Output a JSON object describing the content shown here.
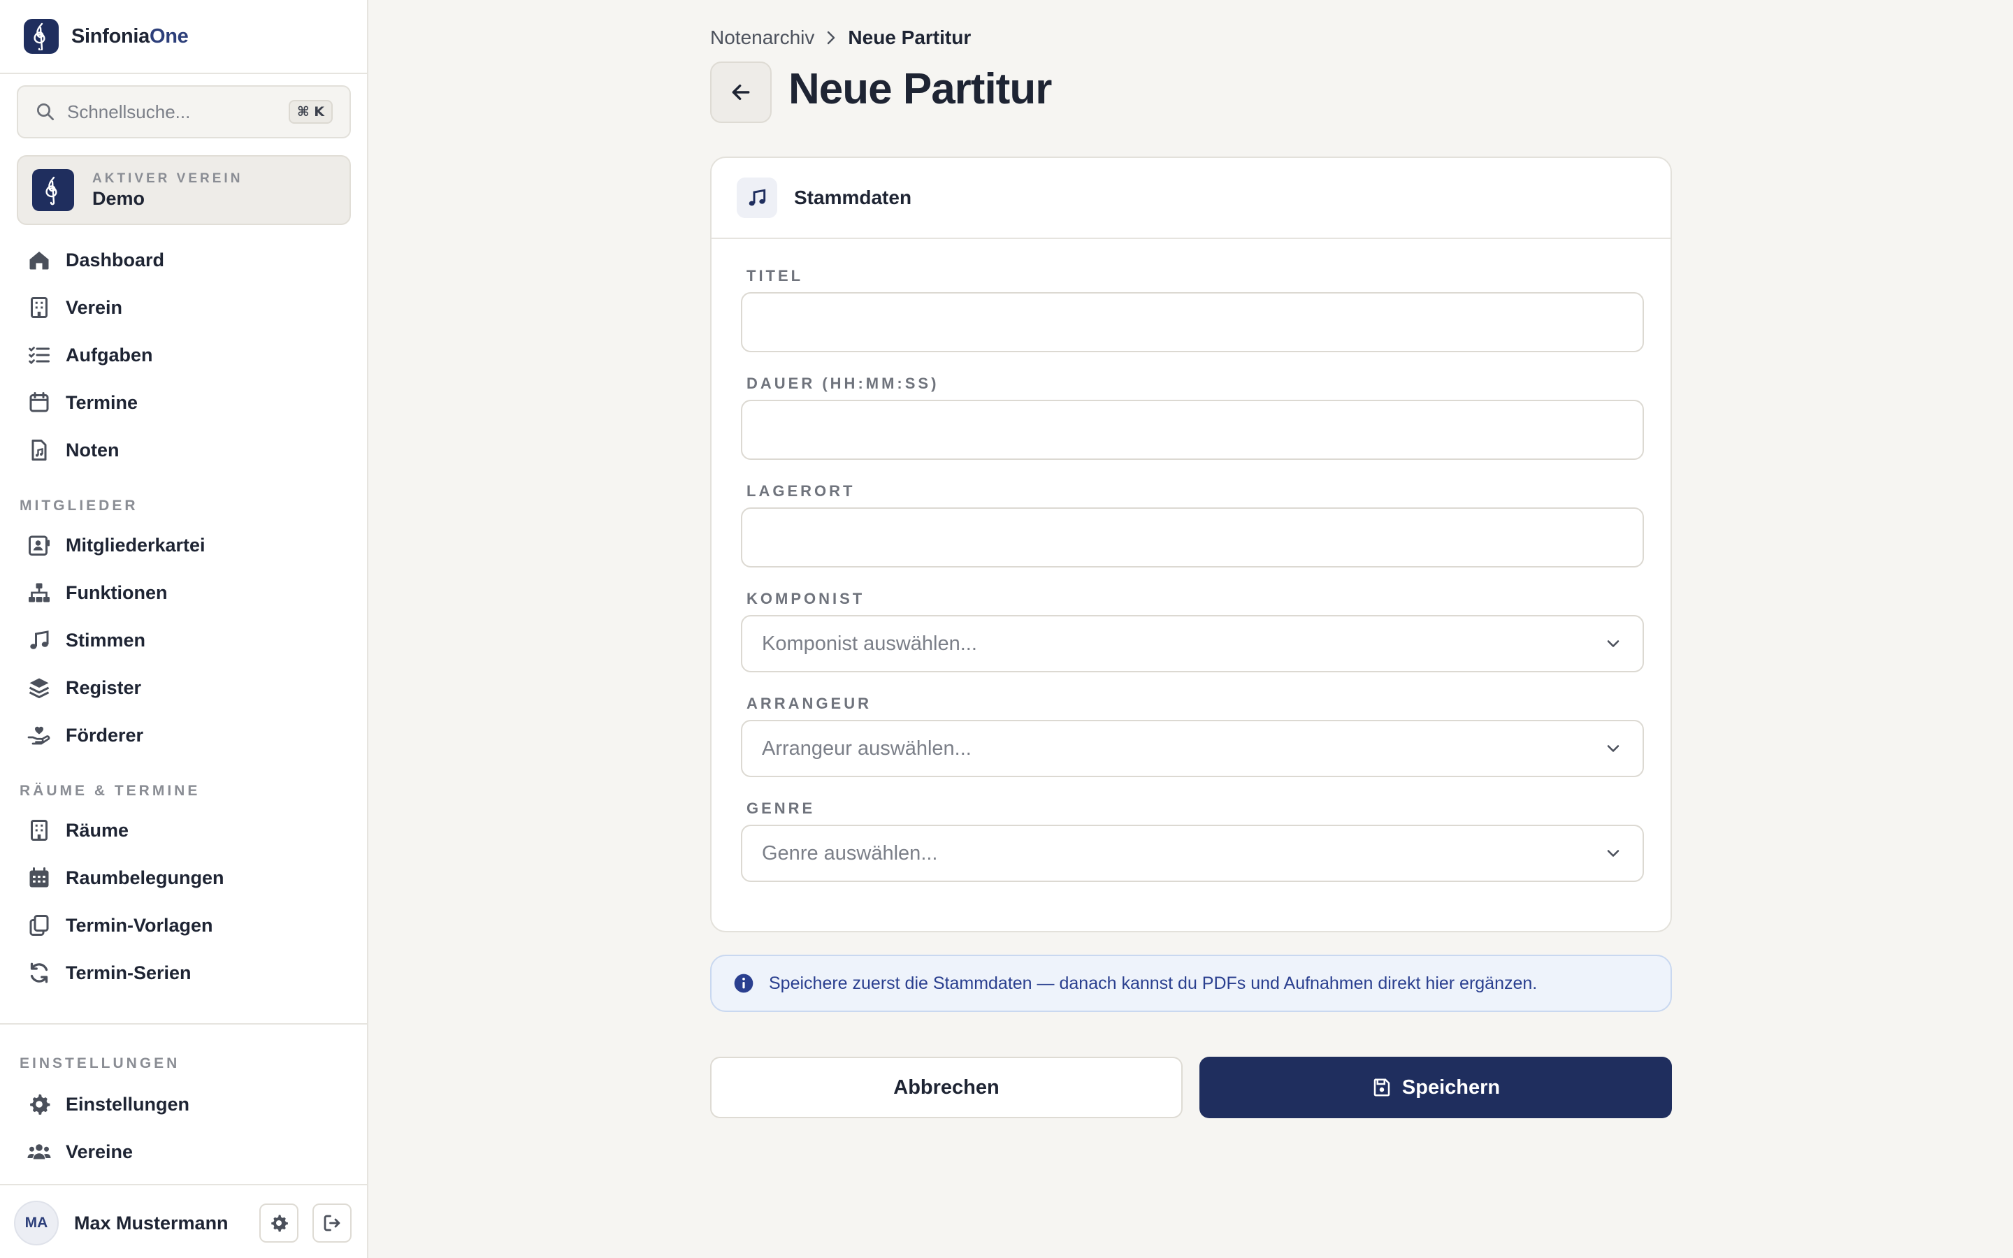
{
  "app": {
    "name_main": "Sinfonia",
    "name_accent": "One"
  },
  "sidebar": {
    "search": {
      "placeholder": "Schnellsuche...",
      "shortcut": "⌘ K"
    },
    "active_club": {
      "kicker": "AKTIVER VEREIN",
      "name": "Demo"
    },
    "main_items": [
      {
        "label": "Dashboard",
        "icon": "home-icon"
      },
      {
        "label": "Verein",
        "icon": "building-icon"
      },
      {
        "label": "Aufgaben",
        "icon": "list-check-icon"
      },
      {
        "label": "Termine",
        "icon": "calendar-icon"
      },
      {
        "label": "Noten",
        "icon": "file-music-icon"
      }
    ],
    "sections": [
      {
        "title": "MITGLIEDER",
        "items": [
          {
            "label": "Mitgliederkartei",
            "icon": "id-card-icon"
          },
          {
            "label": "Funktionen",
            "icon": "sitemap-icon"
          },
          {
            "label": "Stimmen",
            "icon": "music-note-icon"
          },
          {
            "label": "Register",
            "icon": "layers-icon"
          },
          {
            "label": "Förderer",
            "icon": "hand-heart-icon"
          }
        ]
      },
      {
        "title": "RÄUME & TERMINE",
        "items": [
          {
            "label": "Räume",
            "icon": "building-icon"
          },
          {
            "label": "Raumbelegungen",
            "icon": "calendar-grid-icon"
          },
          {
            "label": "Termin-Vorlagen",
            "icon": "copy-icon"
          },
          {
            "label": "Termin-Serien",
            "icon": "repeat-icon"
          }
        ]
      }
    ],
    "settings_section": {
      "title": "EINSTELLUNGEN",
      "items": [
        {
          "label": "Einstellungen",
          "icon": "gear-icon"
        },
        {
          "label": "Vereine",
          "icon": "users-icon"
        }
      ]
    },
    "user": {
      "initials": "MA",
      "name": "Max Mustermann"
    }
  },
  "main": {
    "breadcrumb": {
      "parent": "Notenarchiv",
      "current": "Neue Partitur"
    },
    "title": "Neue Partitur",
    "card": {
      "title": "Stammdaten",
      "fields": {
        "titel": {
          "label": "TITEL",
          "value": ""
        },
        "dauer": {
          "label": "DAUER (HH:MM:SS)",
          "value": ""
        },
        "lagerort": {
          "label": "LAGERORT",
          "value": ""
        },
        "komponist": {
          "label": "KOMPONIST",
          "placeholder": "Komponist auswählen..."
        },
        "arrangeur": {
          "label": "ARRANGEUR",
          "placeholder": "Arrangeur auswählen..."
        },
        "genre": {
          "label": "GENRE",
          "placeholder": "Genre auswählen..."
        }
      }
    },
    "info": "Speichere zuerst die Stammdaten — danach kannst du PDFs und Aufnahmen direkt hier ergänzen.",
    "buttons": {
      "cancel": "Abbrechen",
      "save": "Speichern"
    }
  },
  "colors": {
    "brand_navy": "#1f2e5e",
    "background": "#f6f5f2",
    "info_bg": "#eef3fb",
    "info_text": "#2a3f8f"
  }
}
